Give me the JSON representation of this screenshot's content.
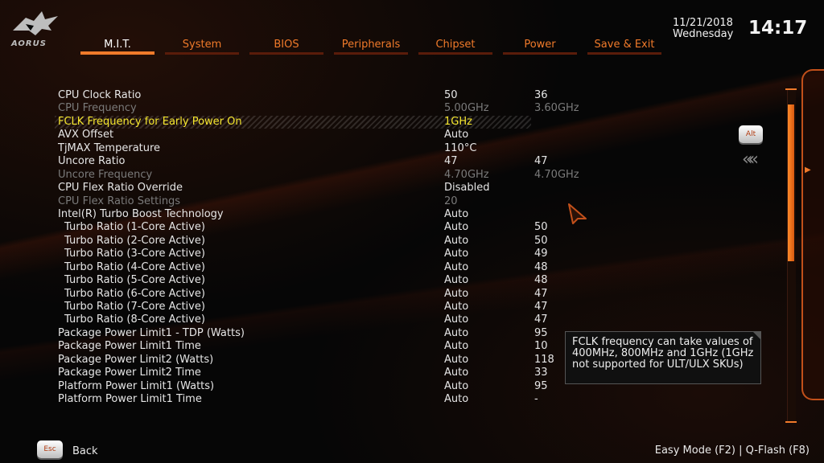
{
  "header": {
    "logo_text": "AORUS",
    "date": "11/21/2018",
    "day": "Wednesday",
    "time": "14:17",
    "tabs": [
      {
        "label": "M.I.T."
      },
      {
        "label": "System"
      },
      {
        "label": "BIOS"
      },
      {
        "label": "Peripherals"
      },
      {
        "label": "Chipset"
      },
      {
        "label": "Power"
      },
      {
        "label": "Save & Exit"
      }
    ],
    "active_tab": "M.I.T."
  },
  "settings": [
    {
      "label": "CPU Clock Ratio",
      "value": "50",
      "value2": "36"
    },
    {
      "label": "CPU Frequency",
      "value": "5.00GHz",
      "value2": "3.60GHz"
    },
    {
      "label": "FCLK Frequency for Early Power On",
      "value": "1GHz",
      "value2": ""
    },
    {
      "label": "AVX Offset",
      "value": "Auto",
      "value2": ""
    },
    {
      "label": "TjMAX Temperature",
      "value": "110°C",
      "value2": ""
    },
    {
      "label": "Uncore Ratio",
      "value": "47",
      "value2": "47"
    },
    {
      "label": "Uncore Frequency",
      "value": "4.70GHz",
      "value2": "4.70GHz"
    },
    {
      "label": "CPU Flex Ratio Override",
      "value": "Disabled",
      "value2": ""
    },
    {
      "label": "CPU Flex Ratio Settings",
      "value": "20",
      "value2": ""
    },
    {
      "label": "Intel(R) Turbo Boost Technology",
      "value": "Auto",
      "value2": ""
    },
    {
      "label": "Turbo Ratio (1-Core Active)",
      "value": "Auto",
      "value2": "50"
    },
    {
      "label": "Turbo Ratio (2-Core Active)",
      "value": "Auto",
      "value2": "50"
    },
    {
      "label": "Turbo Ratio (3-Core Active)",
      "value": "Auto",
      "value2": "49"
    },
    {
      "label": "Turbo Ratio (4-Core Active)",
      "value": "Auto",
      "value2": "48"
    },
    {
      "label": "Turbo Ratio (5-Core Active)",
      "value": "Auto",
      "value2": "48"
    },
    {
      "label": "Turbo Ratio (6-Core Active)",
      "value": "Auto",
      "value2": "47"
    },
    {
      "label": "Turbo Ratio (7-Core Active)",
      "value": "Auto",
      "value2": "47"
    },
    {
      "label": "Turbo Ratio (8-Core Active)",
      "value": "Auto",
      "value2": "47"
    },
    {
      "label": "Package Power Limit1 - TDP (Watts)",
      "value": "Auto",
      "value2": "95"
    },
    {
      "label": "Package Power Limit1 Time",
      "value": "Auto",
      "value2": "10"
    },
    {
      "label": "Package Power Limit2 (Watts)",
      "value": "Auto",
      "value2": "118"
    },
    {
      "label": "Package Power Limit2 Time",
      "value": "Auto",
      "value2": "33"
    },
    {
      "label": "Platform Power Limit1 (Watts)",
      "value": "Auto",
      "value2": "95"
    },
    {
      "label": "Platform Power Limit1 Time",
      "value": "Auto",
      "value2": "-"
    }
  ],
  "help": {
    "text": "FCLK frequency can take values of 400MHz, 800MHz and 1GHz (1GHz not supported for ULT/ULX SKUs)"
  },
  "side": {
    "alt_label": "Alt",
    "collapse_glyph": "«"
  },
  "scrollbar": {
    "position_fraction": 0.0,
    "visible_fraction": 0.47
  },
  "footer": {
    "esc_label": "Esc",
    "back_label": "Back",
    "right_text": "Easy Mode (F2)  |  Q-Flash (F8)"
  },
  "colors": {
    "accent": "#f07a2a",
    "selected_text": "#f5e62e",
    "disabled_text": "#7a7a7a"
  }
}
